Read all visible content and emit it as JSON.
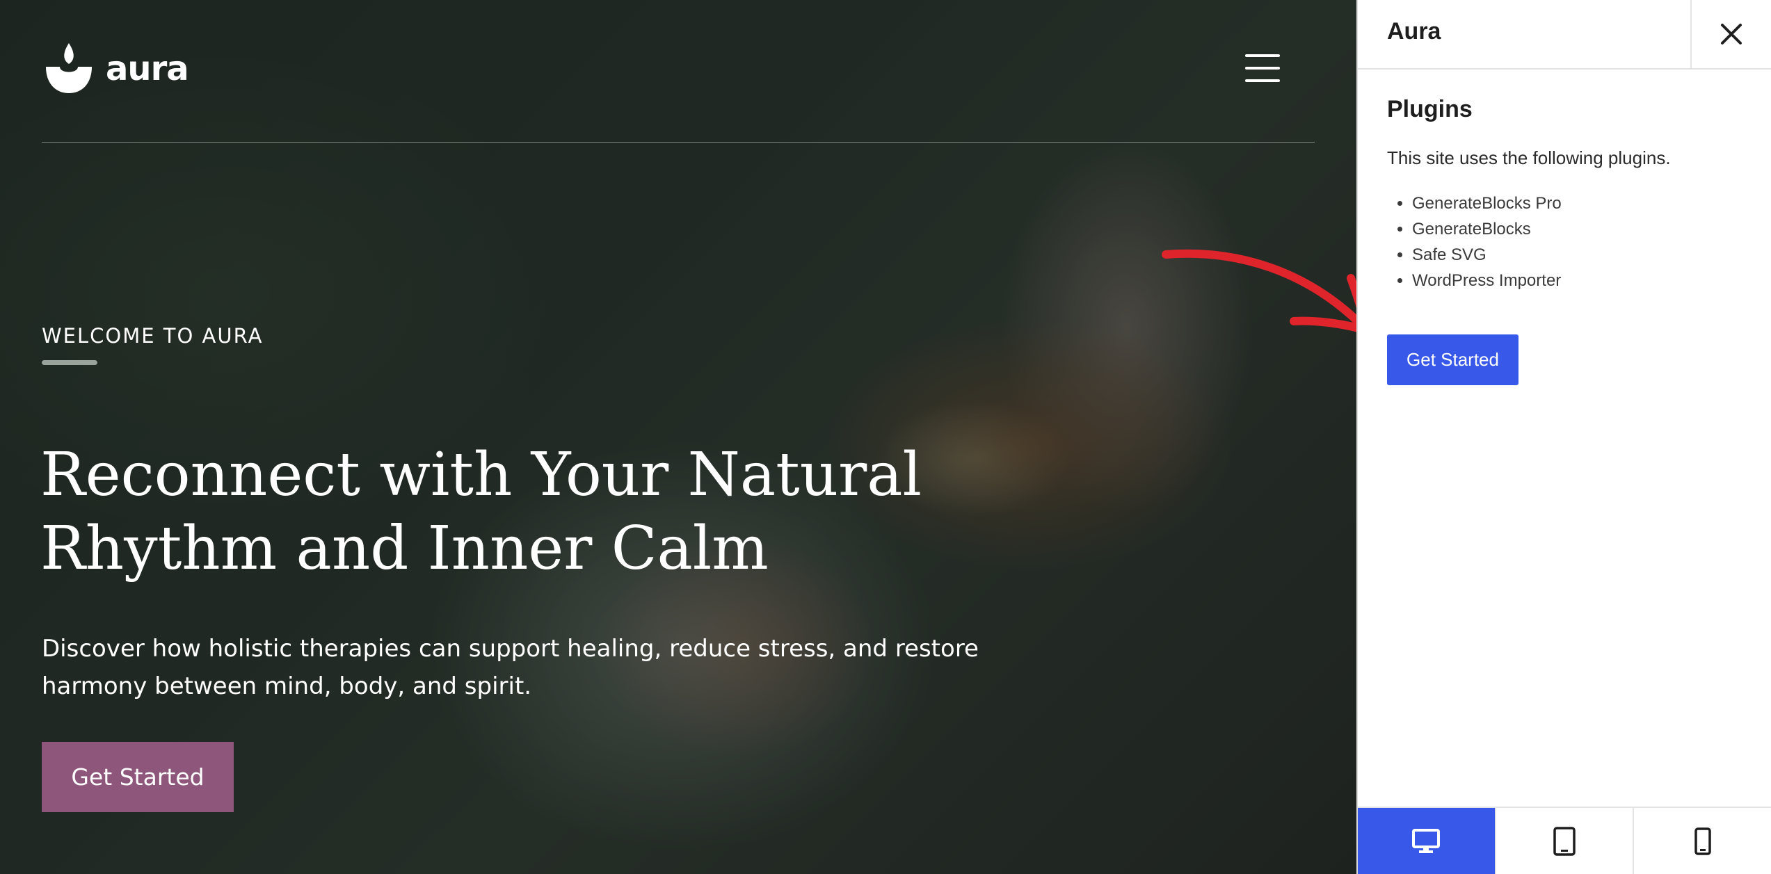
{
  "site": {
    "logo_text": "aura",
    "eyebrow": "WELCOME TO AURA",
    "hero_title_line1": "Reconnect with Your Natural",
    "hero_title_line2": "Rhythm and Inner Calm",
    "hero_text_line1": "Discover how holistic therapies can support healing, reduce stress, and restore",
    "hero_text_line2": "harmony between mind, body, and spirit.",
    "cta_label": "Get Started",
    "accent_color": "#8e567b"
  },
  "panel": {
    "title": "Aura",
    "section_heading": "Plugins",
    "description": "This site uses the following plugins.",
    "plugins": [
      "GenerateBlocks Pro",
      "GenerateBlocks",
      "Safe SVG",
      "WordPress Importer"
    ],
    "button_label": "Get Started",
    "button_color": "#3858e9",
    "close_icon": "close-icon",
    "devices": [
      {
        "name": "desktop-icon",
        "active": true
      },
      {
        "name": "tablet-icon",
        "active": false
      },
      {
        "name": "mobile-icon",
        "active": false
      }
    ]
  }
}
